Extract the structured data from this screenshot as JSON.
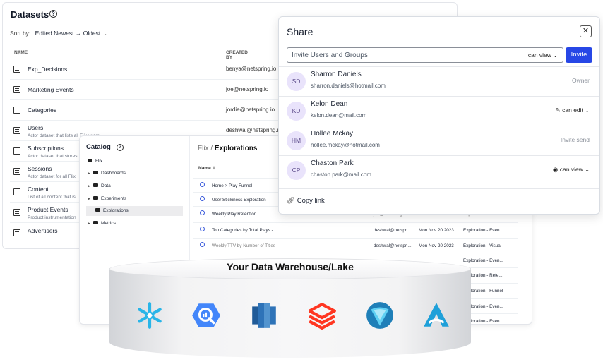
{
  "datasets": {
    "title": "Datasets",
    "sort_label": "Sort by:",
    "sort_value": "Edited Newest → Oldest",
    "columns": [
      "NAME",
      "CREATED BY"
    ],
    "rows": [
      {
        "name": "Exp_Decisions",
        "desc": "",
        "created_by": "benya@netspring.io"
      },
      {
        "name": "Marketing Events",
        "desc": "",
        "created_by": "joe@netspring.io"
      },
      {
        "name": "Categories",
        "desc": "",
        "created_by": "jordie@netspring.io"
      },
      {
        "name": "Users",
        "desc": "Actor dataset that lists all Flix users",
        "created_by": "deshwal@netspring.io"
      },
      {
        "name": "Subscriptions",
        "desc": "Actor dataset that stores",
        "created_by": ""
      },
      {
        "name": "Sessions",
        "desc": "Actor dataset for all Flix",
        "created_by": ""
      },
      {
        "name": "Content",
        "desc": "List of all content that is",
        "created_by": ""
      },
      {
        "name": "Product Events",
        "desc": "Product instrumentation",
        "created_by": ""
      },
      {
        "name": "Advertisers",
        "desc": "",
        "created_by": ""
      }
    ]
  },
  "catalog": {
    "title": "Catalog",
    "tree": [
      {
        "label": "Flix",
        "caret": false
      },
      {
        "label": "Dashboards",
        "caret": true
      },
      {
        "label": "Data",
        "caret": true
      },
      {
        "label": "Experiments",
        "caret": true
      },
      {
        "label": "Explorations",
        "caret": false,
        "selected": true
      },
      {
        "label": "Metrics",
        "caret": true
      }
    ],
    "breadcrumb_root": "Flix",
    "breadcrumb_sep": "/",
    "breadcrumb_current": "Explorations",
    "column_name": "Name",
    "explorations": [
      {
        "name": "Home > Play Funnel",
        "by": "",
        "date": "",
        "type": ""
      },
      {
        "name": "User Stickiness Exploration",
        "by": "",
        "date": "",
        "type": ""
      },
      {
        "name": "Weekly Play Retention",
        "by": "jon@netspring.io",
        "date": "Mon Nov 20 2023",
        "type": "Exploration - Rete..."
      },
      {
        "name": "Top Categories by Total Plays - ...",
        "by": "deshwal@netspri...",
        "date": "Mon Nov 20 2023",
        "type": "Exploration - Even..."
      },
      {
        "name": "Weekly TTV by Number of Titles",
        "by": "deshwal@netspri...",
        "date": "Mon Nov 20 2023",
        "type": "Exploration - Visual"
      }
    ],
    "extra_types": [
      "Exploration - Even...",
      "Exploration - Rete...",
      "Exploration - Funnel",
      "Exploration - Even...",
      "Exploration - Even..."
    ]
  },
  "share": {
    "title": "Share",
    "close": "✕",
    "invite_placeholder": "Invite Users and Groups",
    "invite_permission": "can view",
    "invite_button": "Invite",
    "users": [
      {
        "initials": "SD",
        "name": "Sharron Daniels",
        "email": "sharron.daniels@hotmail.com",
        "role": "Owner",
        "icon": ""
      },
      {
        "initials": "KD",
        "name": "Kelon Dean",
        "email": "kelon.dean@mail.com",
        "role": "can edit",
        "icon": "pencil-icon"
      },
      {
        "initials": "HM",
        "name": "Hollee Mckay",
        "email": "hollee.mckay@hotmail.com",
        "role": "Invite send",
        "icon": ""
      },
      {
        "initials": "CP",
        "name": "Chaston Park",
        "email": "chaston.park@mail.com",
        "role": "can view",
        "icon": "eye-icon"
      }
    ],
    "copy_link": "Copy link"
  },
  "warehouse": {
    "title": "Your Data Warehouse/Lake",
    "logos": [
      "snowflake-logo",
      "bigquery-logo",
      "redshift-logo",
      "databricks-logo",
      "dremio-logo",
      "athena-logo"
    ],
    "colors": {
      "snowflake": "#29b5e8",
      "bigquery": "#4386fa",
      "redshift": "#2e73b8",
      "databricks": "#ff3621",
      "dremio": "#31b1e0",
      "athena": "#1ea0d9"
    }
  },
  "colors": {
    "accent": "#2747e6",
    "avatar_bg": "#e9e3fb"
  }
}
